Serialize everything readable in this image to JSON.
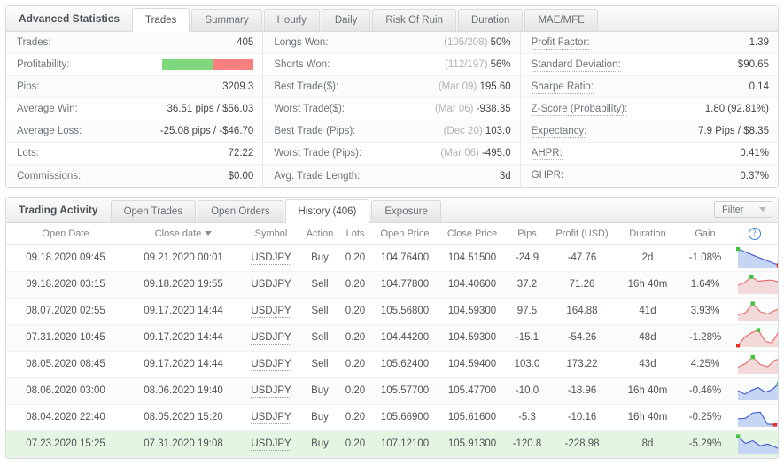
{
  "advanced_statistics": {
    "title": "Advanced Statistics",
    "tabs": [
      {
        "label": "Trades",
        "active": true
      },
      {
        "label": "Summary",
        "active": false
      },
      {
        "label": "Hourly",
        "active": false
      },
      {
        "label": "Daily",
        "active": false
      },
      {
        "label": "Risk Of Ruin",
        "active": false
      },
      {
        "label": "Duration",
        "active": false
      },
      {
        "label": "MAE/MFE",
        "active": false
      }
    ],
    "columns": [
      {
        "rows": [
          {
            "label": "Trades:",
            "value": "405",
            "type": "text"
          },
          {
            "label": "Profitability:",
            "value": "",
            "type": "bar",
            "green_pct": 55,
            "red_pct": 45
          },
          {
            "label": "Pips:",
            "value": "3209.3",
            "type": "text"
          },
          {
            "label": "Average Win:",
            "value": "36.51 pips / $56.03",
            "type": "text"
          },
          {
            "label": "Average Loss:",
            "value": "-25.08 pips / -$46.70",
            "type": "text"
          },
          {
            "label": "Lots:",
            "value": "72.22",
            "type": "text"
          },
          {
            "label": "Commissions:",
            "value": "$0.00",
            "type": "text"
          }
        ]
      },
      {
        "rows": [
          {
            "label": "Longs Won:",
            "muted": "(105/208)",
            "value": "50%",
            "type": "text"
          },
          {
            "label": "Shorts Won:",
            "muted": "(112/197)",
            "value": "56%",
            "type": "text"
          },
          {
            "label": "Best Trade($):",
            "muted": "(Mar 09)",
            "value": "195.60",
            "type": "text"
          },
          {
            "label": "Worst Trade($):",
            "muted": "(Mar 06)",
            "value": "-938.35",
            "type": "text"
          },
          {
            "label": "Best Trade (Pips):",
            "muted": "(Dec 20)",
            "value": "103.0",
            "type": "text"
          },
          {
            "label": "Worst Trade (Pips):",
            "muted": "(Mar 06)",
            "value": "-495.0",
            "type": "text"
          },
          {
            "label": "Avg. Trade Length:",
            "muted": "",
            "value": "3d",
            "type": "text"
          }
        ]
      },
      {
        "dotted": true,
        "rows": [
          {
            "label": "Profit Factor:",
            "value": "1.39",
            "type": "text"
          },
          {
            "label": "Standard Deviation:",
            "value": "$90.65",
            "type": "text"
          },
          {
            "label": "Sharpe Ratio:",
            "value": "0.14",
            "type": "text"
          },
          {
            "label": "Z-Score (Probability):",
            "value": "1.80 (92.81%)",
            "type": "text"
          },
          {
            "label": "Expectancy:",
            "value": "7.9 Pips / $8.35",
            "type": "text"
          },
          {
            "label": "AHPR:",
            "value": "0.41%",
            "type": "text"
          },
          {
            "label": "GHPR:",
            "value": "0.37%",
            "type": "text"
          }
        ]
      }
    ]
  },
  "trading_activity": {
    "title": "Trading Activity",
    "tabs": [
      {
        "label": "Open Trades",
        "active": false
      },
      {
        "label": "Open Orders",
        "active": false
      },
      {
        "label": "History (406)",
        "active": true
      },
      {
        "label": "Exposure",
        "active": false
      }
    ],
    "filter_label": "Filter",
    "columns": [
      "Open Date",
      "Close date",
      "Symbol",
      "Action",
      "Lots",
      "Open Price",
      "Close Price",
      "Pips",
      "Profit (USD)",
      "Duration",
      "Gain",
      ""
    ],
    "sorted_column": "Close date",
    "help_icon": "question-mark-icon",
    "rows": [
      {
        "open_date": "09.18.2020 09:45",
        "close_date": "09.21.2020 00:01",
        "symbol": "USDJPY",
        "action": "Buy",
        "lots": "0.20",
        "open_price": "104.76400",
        "close_price": "104.51500",
        "pips": "-24.9",
        "pips_sign": "neg",
        "profit": "-47.76",
        "profit_sign": "neg",
        "duration": "2d",
        "gain": "-1.08%",
        "spark_color": "blue",
        "spark_points": [
          0.95,
          0.52,
          0.12,
          0.46,
          0.72
        ],
        "highlight": false
      },
      {
        "open_date": "09.18.2020 03:15",
        "close_date": "09.18.2020 19:55",
        "symbol": "USDJPY",
        "action": "Sell",
        "lots": "0.20",
        "open_price": "104.77800",
        "close_price": "104.40600",
        "pips": "37.2",
        "pips_sign": "pos",
        "profit": "71.26",
        "profit_sign": "pos",
        "duration": "16h 40m",
        "gain": "1.64%",
        "spark_color": "red",
        "spark_points": [
          0.45,
          0.6,
          0.88,
          0.66,
          0.7,
          0.72,
          0.62,
          0.1,
          0.12,
          0.34,
          0.22,
          0.4,
          0.44
        ],
        "highlight": false
      },
      {
        "open_date": "08.07.2020 02:55",
        "close_date": "09.17.2020 14:44",
        "symbol": "USDJPY",
        "action": "Sell",
        "lots": "0.20",
        "open_price": "105.56800",
        "close_price": "104.59300",
        "pips": "97.5",
        "pips_sign": "pos",
        "profit": "164.88",
        "profit_sign": "pos",
        "duration": "41d",
        "gain": "3.93%",
        "spark_color": "red",
        "spark_points": [
          0.3,
          0.4,
          0.88,
          0.46,
          0.34,
          0.52,
          0.68,
          0.72,
          0.64,
          0.3,
          0.08,
          0.08
        ],
        "highlight": false
      },
      {
        "open_date": "07.31.2020 10:45",
        "close_date": "09.17.2020 14:44",
        "symbol": "USDJPY",
        "action": "Sell",
        "lots": "0.20",
        "open_price": "104.44200",
        "close_price": "104.59300",
        "pips": "-15.1",
        "pips_sign": "neg",
        "profit": "-54.26",
        "profit_sign": "neg",
        "duration": "48d",
        "gain": "-1.28%",
        "spark_color": "red",
        "spark_points": [
          0.08,
          0.52,
          0.74,
          0.88,
          0.3,
          0.22,
          0.8,
          0.34,
          0.26,
          0.66,
          0.42,
          0.1,
          0.12
        ],
        "highlight": false
      },
      {
        "open_date": "08.05.2020 08:45",
        "close_date": "09.17.2020 14:44",
        "symbol": "USDJPY",
        "action": "Sell",
        "lots": "0.20",
        "open_price": "105.62400",
        "close_price": "104.59400",
        "pips": "103.0",
        "pips_sign": "pos",
        "profit": "173.22",
        "profit_sign": "pos",
        "duration": "43d",
        "gain": "4.25%",
        "spark_color": "red",
        "spark_points": [
          0.34,
          0.52,
          0.86,
          0.48,
          0.36,
          0.7,
          0.8,
          0.76,
          0.62,
          0.28,
          0.12,
          0.1
        ],
        "highlight": false
      },
      {
        "open_date": "08.06.2020 03:00",
        "close_date": "08.06.2020 19:40",
        "symbol": "USDJPY",
        "action": "Buy",
        "lots": "0.20",
        "open_price": "105.57700",
        "close_price": "105.47700",
        "pips": "-10.0",
        "pips_sign": "neg",
        "profit": "-18.96",
        "profit_sign": "neg",
        "duration": "16h 40m",
        "gain": "-0.46%",
        "spark_color": "blue",
        "spark_points": [
          0.5,
          0.32,
          0.52,
          0.66,
          0.42,
          0.54,
          0.86,
          0.58,
          0.34,
          0.12,
          0.46,
          0.68,
          0.52
        ],
        "highlight": false
      },
      {
        "open_date": "08.04.2020 22:40",
        "close_date": "08.05.2020 15:20",
        "symbol": "USDJPY",
        "action": "Buy",
        "lots": "0.20",
        "open_price": "105.66900",
        "close_price": "105.61600",
        "pips": "-5.3",
        "pips_sign": "neg",
        "profit": "-10.16",
        "profit_sign": "neg",
        "duration": "16h 40m",
        "gain": "-0.25%",
        "spark_color": "blue",
        "spark_points": [
          0.42,
          0.44,
          0.72,
          0.76,
          0.14,
          0.12,
          0.36,
          0.3,
          0.44,
          0.84,
          0.52,
          0.28
        ],
        "highlight": false
      },
      {
        "open_date": "07.23.2020 15:25",
        "close_date": "07.31.2020 19:08",
        "symbol": "USDJPY",
        "action": "Buy",
        "lots": "0.20",
        "open_price": "107.12100",
        "close_price": "105.91300",
        "pips": "-120.8",
        "pips_sign": "neg",
        "profit": "-228.98",
        "profit_sign": "neg",
        "duration": "8d",
        "gain": "-5.29%",
        "spark_color": "blue",
        "spark_points": [
          0.88,
          0.52,
          0.66,
          0.4,
          0.48,
          0.34,
          0.14,
          0.08,
          0.46,
          0.5,
          0.56,
          0.62
        ],
        "highlight": true
      }
    ]
  },
  "colors": {
    "positive": "#3faf46",
    "negative": "#f0403a",
    "bar_green": "#7ed97e",
    "bar_red": "#fa8080",
    "spark_blue": "#4a5fd0",
    "spark_blue_fill": "#c5d6f5",
    "spark_red": "#e8716f",
    "spark_red_fill": "#f2dada",
    "marker_start": "#3fc33f",
    "marker_low": "#e83020",
    "marker_end": "#f59a20",
    "row_highlight": "#e4f5e2",
    "help_icon": "#3b7fd4"
  }
}
